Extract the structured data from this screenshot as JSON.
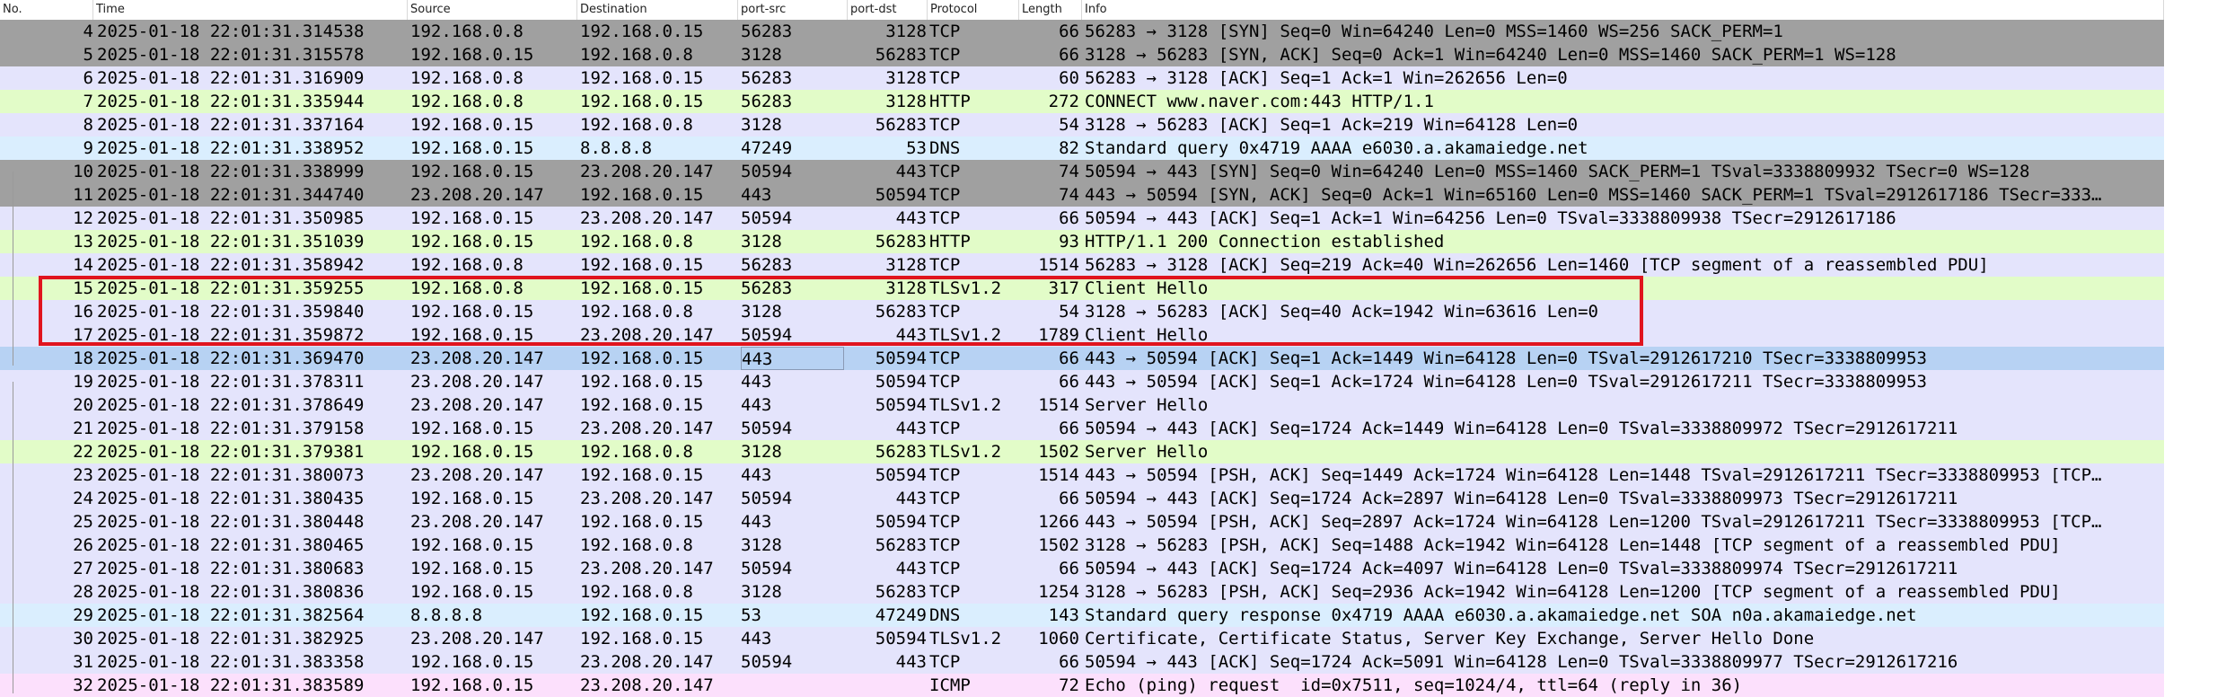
{
  "columns": [
    "No.",
    "Time",
    "Source",
    "Destination",
    "port-src",
    "port-dst",
    "Protocol",
    "Length",
    "Info"
  ],
  "colors": {
    "gray": "#a0a0a0",
    "lavender": "#e4e4fc",
    "green": "#e2fcc8",
    "blue": "#daeefe",
    "selected": "#b7d2f3",
    "pink": "#fce0fc",
    "highlight_border": "#e0141e"
  },
  "packets": [
    {
      "no": "4",
      "time": "2025-01-18 22:01:31.314538",
      "src": "192.168.0.8",
      "dst": "192.168.0.15",
      "sport": "56283",
      "dport": "3128",
      "proto": "TCP",
      "len": "66",
      "info": "56283 → 3128 [SYN] Seq=0 Win=64240 Len=0 MSS=1460 WS=256 SACK_PERM=1",
      "color": "gray"
    },
    {
      "no": "5",
      "time": "2025-01-18 22:01:31.315578",
      "src": "192.168.0.15",
      "dst": "192.168.0.8",
      "sport": "3128",
      "dport": "56283",
      "proto": "TCP",
      "len": "66",
      "info": "3128 → 56283 [SYN, ACK] Seq=0 Ack=1 Win=64240 Len=0 MSS=1460 SACK_PERM=1 WS=128",
      "color": "gray"
    },
    {
      "no": "6",
      "time": "2025-01-18 22:01:31.316909",
      "src": "192.168.0.8",
      "dst": "192.168.0.15",
      "sport": "56283",
      "dport": "3128",
      "proto": "TCP",
      "len": "60",
      "info": "56283 → 3128 [ACK] Seq=1 Ack=1 Win=262656 Len=0",
      "color": "lavender"
    },
    {
      "no": "7",
      "time": "2025-01-18 22:01:31.335944",
      "src": "192.168.0.8",
      "dst": "192.168.0.15",
      "sport": "56283",
      "dport": "3128",
      "proto": "HTTP",
      "len": "272",
      "info": "CONNECT www.naver.com:443 HTTP/1.1",
      "color": "green"
    },
    {
      "no": "8",
      "time": "2025-01-18 22:01:31.337164",
      "src": "192.168.0.15",
      "dst": "192.168.0.8",
      "sport": "3128",
      "dport": "56283",
      "proto": "TCP",
      "len": "54",
      "info": "3128 → 56283 [ACK] Seq=1 Ack=219 Win=64128 Len=0",
      "color": "lavender"
    },
    {
      "no": "9",
      "time": "2025-01-18 22:01:31.338952",
      "src": "192.168.0.15",
      "dst": "8.8.8.8",
      "sport": "47249",
      "dport": "53",
      "proto": "DNS",
      "len": "82",
      "info": "Standard query 0x4719 AAAA e6030.a.akamaiedge.net",
      "color": "blue"
    },
    {
      "no": "10",
      "time": "2025-01-18 22:01:31.338999",
      "src": "192.168.0.15",
      "dst": "23.208.20.147",
      "sport": "50594",
      "dport": "443",
      "proto": "TCP",
      "len": "74",
      "info": "50594 → 443 [SYN] Seq=0 Win=64240 Len=0 MSS=1460 SACK_PERM=1 TSval=3338809932 TSecr=0 WS=128",
      "color": "gray"
    },
    {
      "no": "11",
      "time": "2025-01-18 22:01:31.344740",
      "src": "23.208.20.147",
      "dst": "192.168.0.15",
      "sport": "443",
      "dport": "50594",
      "proto": "TCP",
      "len": "74",
      "info": "443 → 50594 [SYN, ACK] Seq=0 Ack=1 Win=65160 Len=0 MSS=1460 SACK_PERM=1 TSval=2912617186 TSecr=333…",
      "color": "gray"
    },
    {
      "no": "12",
      "time": "2025-01-18 22:01:31.350985",
      "src": "192.168.0.15",
      "dst": "23.208.20.147",
      "sport": "50594",
      "dport": "443",
      "proto": "TCP",
      "len": "66",
      "info": "50594 → 443 [ACK] Seq=1 Ack=1 Win=64256 Len=0 TSval=3338809938 TSecr=2912617186",
      "color": "lavender"
    },
    {
      "no": "13",
      "time": "2025-01-18 22:01:31.351039",
      "src": "192.168.0.15",
      "dst": "192.168.0.8",
      "sport": "3128",
      "dport": "56283",
      "proto": "HTTP",
      "len": "93",
      "info": "HTTP/1.1 200 Connection established",
      "color": "green"
    },
    {
      "no": "14",
      "time": "2025-01-18 22:01:31.358942",
      "src": "192.168.0.8",
      "dst": "192.168.0.15",
      "sport": "56283",
      "dport": "3128",
      "proto": "TCP",
      "len": "1514",
      "info": "56283 → 3128 [ACK] Seq=219 Ack=40 Win=262656 Len=1460 [TCP segment of a reassembled PDU]",
      "color": "lavender"
    },
    {
      "no": "15",
      "time": "2025-01-18 22:01:31.359255",
      "src": "192.168.0.8",
      "dst": "192.168.0.15",
      "sport": "56283",
      "dport": "3128",
      "proto": "TLSv1.2",
      "len": "317",
      "info": "Client Hello",
      "color": "green"
    },
    {
      "no": "16",
      "time": "2025-01-18 22:01:31.359840",
      "src": "192.168.0.15",
      "dst": "192.168.0.8",
      "sport": "3128",
      "dport": "56283",
      "proto": "TCP",
      "len": "54",
      "info": "3128 → 56283 [ACK] Seq=40 Ack=1942 Win=63616 Len=0",
      "color": "lavender"
    },
    {
      "no": "17",
      "time": "2025-01-18 22:01:31.359872",
      "src": "192.168.0.15",
      "dst": "23.208.20.147",
      "sport": "50594",
      "dport": "443",
      "proto": "TLSv1.2",
      "len": "1789",
      "info": "Client Hello",
      "color": "lavender"
    },
    {
      "no": "18",
      "time": "2025-01-18 22:01:31.369470",
      "src": "23.208.20.147",
      "dst": "192.168.0.15",
      "sport": "443",
      "dport": "50594",
      "proto": "TCP",
      "len": "66",
      "info": "443 → 50594 [ACK] Seq=1 Ack=1449 Win=64128 Len=0 TSval=2912617210 TSecr=3338809953",
      "color": "selected"
    },
    {
      "no": "19",
      "time": "2025-01-18 22:01:31.378311",
      "src": "23.208.20.147",
      "dst": "192.168.0.15",
      "sport": "443",
      "dport": "50594",
      "proto": "TCP",
      "len": "66",
      "info": "443 → 50594 [ACK] Seq=1 Ack=1724 Win=64128 Len=0 TSval=2912617211 TSecr=3338809953",
      "color": "lavender"
    },
    {
      "no": "20",
      "time": "2025-01-18 22:01:31.378649",
      "src": "23.208.20.147",
      "dst": "192.168.0.15",
      "sport": "443",
      "dport": "50594",
      "proto": "TLSv1.2",
      "len": "1514",
      "info": "Server Hello",
      "color": "lavender"
    },
    {
      "no": "21",
      "time": "2025-01-18 22:01:31.379158",
      "src": "192.168.0.15",
      "dst": "23.208.20.147",
      "sport": "50594",
      "dport": "443",
      "proto": "TCP",
      "len": "66",
      "info": "50594 → 443 [ACK] Seq=1724 Ack=1449 Win=64128 Len=0 TSval=3338809972 TSecr=2912617211",
      "color": "lavender"
    },
    {
      "no": "22",
      "time": "2025-01-18 22:01:31.379381",
      "src": "192.168.0.15",
      "dst": "192.168.0.8",
      "sport": "3128",
      "dport": "56283",
      "proto": "TLSv1.2",
      "len": "1502",
      "info": "Server Hello",
      "color": "green"
    },
    {
      "no": "23",
      "time": "2025-01-18 22:01:31.380073",
      "src": "23.208.20.147",
      "dst": "192.168.0.15",
      "sport": "443",
      "dport": "50594",
      "proto": "TCP",
      "len": "1514",
      "info": "443 → 50594 [PSH, ACK] Seq=1449 Ack=1724 Win=64128 Len=1448 TSval=2912617211 TSecr=3338809953 [TCP…",
      "color": "lavender"
    },
    {
      "no": "24",
      "time": "2025-01-18 22:01:31.380435",
      "src": "192.168.0.15",
      "dst": "23.208.20.147",
      "sport": "50594",
      "dport": "443",
      "proto": "TCP",
      "len": "66",
      "info": "50594 → 443 [ACK] Seq=1724 Ack=2897 Win=64128 Len=0 TSval=3338809973 TSecr=2912617211",
      "color": "lavender"
    },
    {
      "no": "25",
      "time": "2025-01-18 22:01:31.380448",
      "src": "23.208.20.147",
      "dst": "192.168.0.15",
      "sport": "443",
      "dport": "50594",
      "proto": "TCP",
      "len": "1266",
      "info": "443 → 50594 [PSH, ACK] Seq=2897 Ack=1724 Win=64128 Len=1200 TSval=2912617211 TSecr=3338809953 [TCP…",
      "color": "lavender"
    },
    {
      "no": "26",
      "time": "2025-01-18 22:01:31.380465",
      "src": "192.168.0.15",
      "dst": "192.168.0.8",
      "sport": "3128",
      "dport": "56283",
      "proto": "TCP",
      "len": "1502",
      "info": "3128 → 56283 [PSH, ACK] Seq=1488 Ack=1942 Win=64128 Len=1448 [TCP segment of a reassembled PDU]",
      "color": "lavender"
    },
    {
      "no": "27",
      "time": "2025-01-18 22:01:31.380683",
      "src": "192.168.0.15",
      "dst": "23.208.20.147",
      "sport": "50594",
      "dport": "443",
      "proto": "TCP",
      "len": "66",
      "info": "50594 → 443 [ACK] Seq=1724 Ack=4097 Win=64128 Len=0 TSval=3338809974 TSecr=2912617211",
      "color": "lavender"
    },
    {
      "no": "28",
      "time": "2025-01-18 22:01:31.380836",
      "src": "192.168.0.15",
      "dst": "192.168.0.8",
      "sport": "3128",
      "dport": "56283",
      "proto": "TCP",
      "len": "1254",
      "info": "3128 → 56283 [PSH, ACK] Seq=2936 Ack=1942 Win=64128 Len=1200 [TCP segment of a reassembled PDU]",
      "color": "lavender"
    },
    {
      "no": "29",
      "time": "2025-01-18 22:01:31.382564",
      "src": "8.8.8.8",
      "dst": "192.168.0.15",
      "sport": "53",
      "dport": "47249",
      "proto": "DNS",
      "len": "143",
      "info": "Standard query response 0x4719 AAAA e6030.a.akamaiedge.net SOA n0a.akamaiedge.net",
      "color": "blue"
    },
    {
      "no": "30",
      "time": "2025-01-18 22:01:31.382925",
      "src": "23.208.20.147",
      "dst": "192.168.0.15",
      "sport": "443",
      "dport": "50594",
      "proto": "TLSv1.2",
      "len": "1060",
      "info": "Certificate, Certificate Status, Server Key Exchange, Server Hello Done",
      "color": "lavender"
    },
    {
      "no": "31",
      "time": "2025-01-18 22:01:31.383358",
      "src": "192.168.0.15",
      "dst": "23.208.20.147",
      "sport": "50594",
      "dport": "443",
      "proto": "TCP",
      "len": "66",
      "info": "50594 → 443 [ACK] Seq=1724 Ack=5091 Win=64128 Len=0 TSval=3338809977 TSecr=2912617216",
      "color": "lavender"
    },
    {
      "no": "32",
      "time": "2025-01-18 22:01:31.383589",
      "src": "192.168.0.15",
      "dst": "23.208.20.147",
      "sport": "",
      "dport": "",
      "proto": "ICMP",
      "len": "72",
      "info": "Echo (ping) request  id=0x7511, seq=1024/4, ttl=64 (reply in 36)",
      "color": "pink"
    }
  ]
}
